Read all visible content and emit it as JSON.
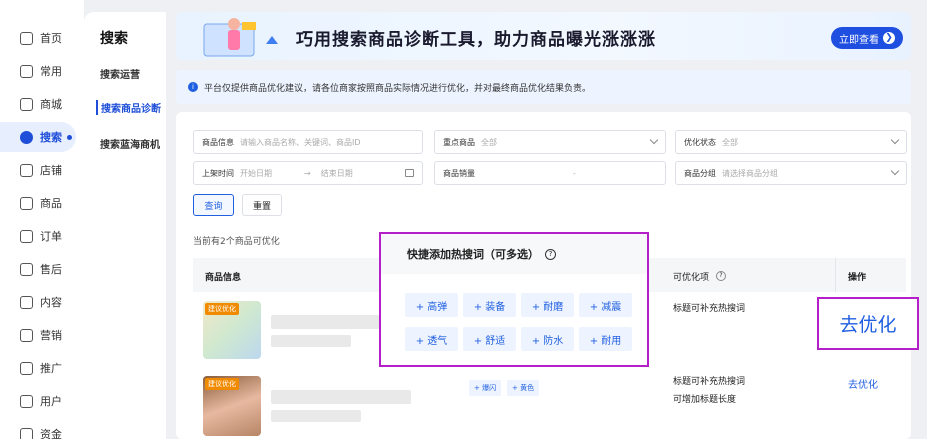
{
  "rail": [
    {
      "label": "首页",
      "icon": "home-icon"
    },
    {
      "label": "常用",
      "icon": "folder-icon"
    },
    {
      "label": "商城",
      "icon": "shop-icon"
    },
    {
      "label": "搜索",
      "icon": "search-icon",
      "active": true
    },
    {
      "label": "店铺",
      "icon": "store-icon"
    },
    {
      "label": "商品",
      "icon": "goods-icon"
    },
    {
      "label": "订单",
      "icon": "order-icon"
    },
    {
      "label": "售后",
      "icon": "aftersale-icon"
    },
    {
      "label": "内容",
      "icon": "content-icon"
    },
    {
      "label": "营销",
      "icon": "megaphone-icon"
    },
    {
      "label": "推广",
      "icon": "promote-icon"
    },
    {
      "label": "用户",
      "icon": "user-icon"
    },
    {
      "label": "资金",
      "icon": "wallet-icon"
    }
  ],
  "sub": {
    "title": "搜索",
    "items": [
      "搜索运营",
      "搜索商品诊断",
      "搜索蓝海商机"
    ]
  },
  "banner": {
    "title": "巧用搜索商品诊断工具，助力商品曝光涨涨涨",
    "button": "立即查看",
    "button_arrow": "❯"
  },
  "notice": {
    "icon_text": "i",
    "text": "平台仅提供商品优化建议，请各位商家按照商品实际情况进行优化，并对最终商品优化结果负责。"
  },
  "filters": {
    "goods_info_label": "商品信息",
    "goods_info_placeholder": "请输入商品名称、关键词、商品ID",
    "key_goods_label": "重点商品",
    "key_goods_value": "全部",
    "opt_status_label": "优化状态",
    "opt_status_value": "全部",
    "list_time_label": "上架时间",
    "start_date": "开始日期",
    "date_sep": "→",
    "end_date": "结束日期",
    "sales_label": "商品销量",
    "sales_sep": "-",
    "group_label": "商品分组",
    "group_placeholder": "请选择商品分组",
    "query_button": "查询",
    "reset_button": "重置"
  },
  "count_text": "当前有2个商品可优化",
  "table": {
    "col_goods": "商品信息",
    "col_opt": "可优化项",
    "col_opt_help": "?",
    "col_action": "操作"
  },
  "rows": [
    {
      "tag": "建议优化",
      "opt": [
        "标题可补充热搜词"
      ],
      "action": "去优化"
    },
    {
      "tag": "建议优化",
      "chips": [
        "+ 爆闪",
        "+ 黄色"
      ],
      "opt": [
        "标题可补充热搜词",
        "可增加标题长度"
      ],
      "action": "去优化"
    }
  ],
  "popover": {
    "title": "快捷添加热搜词（可多选）",
    "help": "?",
    "keywords": [
      "+ 高弹",
      "+ 装备",
      "+ 耐磨",
      "+ 减震",
      "+ 透气",
      "+ 舒适",
      "+ 防水",
      "+ 耐用"
    ]
  },
  "go_big": "去优化",
  "colors": {
    "accent": "#1f5fe0",
    "highlight": "#b41fc9",
    "tag": "#f08a00"
  }
}
